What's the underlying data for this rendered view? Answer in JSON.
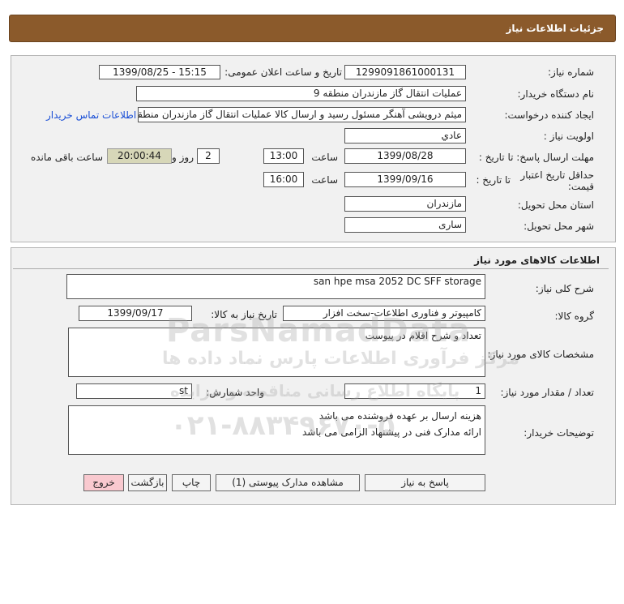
{
  "page": {
    "title": "جزئیات اطلاعات نیاز"
  },
  "details": {
    "need_number_label": "شماره نیاز:",
    "need_number": "1299091861000131",
    "announce_label": "تاریخ و ساعت اعلان عمومی:",
    "announce_value": "1399/08/25 - 15:15",
    "buyer_org_label": "نام دستگاه خریدار:",
    "buyer_org": "عملیات انتقال گاز مازندران منطقه 9",
    "requester_label": "ایجاد کننده درخواست:",
    "requester": "میثم درویشی آهنگر مسئول رسید و ارسال کالا عملیات انتقال گاز مازندران منطقه 9",
    "contact_link": "اطلاعات تماس خریدار",
    "priority_label": "اولویت نیاز :",
    "priority": "عادي",
    "deadline_label": "مهلت ارسال پاسخ: تا تاریخ :",
    "deadline_date": "1399/08/28",
    "time_label": "ساعت",
    "deadline_time": "13:00",
    "days_value": "2",
    "days_label": "روز و",
    "remaining_time": "20:00:44",
    "remaining_label": "ساعت باقی مانده",
    "validity_label": "حداقل تاریخ اعتبار قیمت:",
    "validity_to_label": "تا تاریخ :",
    "validity_date": "1399/09/16",
    "validity_time_label": "ساعت",
    "validity_time": "16:00",
    "province_label": "استان محل تحویل:",
    "province": "مازندران",
    "city_label": "شهر محل تحویل:",
    "city": "ساری"
  },
  "goods": {
    "section_title": "اطلاعات کالاهای مورد نیاز",
    "summary_label": "شرح کلی نیاز:",
    "summary": "san hpe msa 2052 DC SFF storage",
    "group_label": "گروه کالا:",
    "group": "کامپیوتر و فناوری اطلاعات-سخت افزار",
    "need_date_label": "تاریخ نیاز به کالا:",
    "need_date": "1399/09/17",
    "specs_label": "مشخصات کالای مورد نیاز:",
    "specs": "تعداد و شرح اقلام در پیوست",
    "qty_label": "تعداد / مقدار مورد نیاز:",
    "qty": "1",
    "unit_label": "واحد شمارش:",
    "unit": "st",
    "notes_label": "توضیحات خریدار:",
    "notes_line1": "هزینه ارسال بر عهده فروشنده می باشد",
    "notes_line2": "ارائه مدارک فنی در پیشنهاد الزامی می باشد"
  },
  "buttons": {
    "reply": "پاسخ به نیاز",
    "attachments": "مشاهده مدارک پیوستی (1)",
    "print": "چاپ",
    "back": "بازگشت",
    "exit": "خروج"
  },
  "watermark": {
    "brand": "ParsNamadData",
    "line1": "مرکز فرآوری اطلاعات پارس نماد داده ها",
    "line2": "پایگاه اطلاع رسانی مناقصه و مزایده",
    "phone": "۰۲۱-۸۸۳۴۹۶۷۰-۵"
  },
  "colors": {
    "header_bg": "#8b5a2b",
    "panel_bg": "#f1f1f1",
    "link": "#1a4fd6",
    "remaining_bg": "#d7d7b8",
    "exit_bg": "#f9c9cf"
  }
}
